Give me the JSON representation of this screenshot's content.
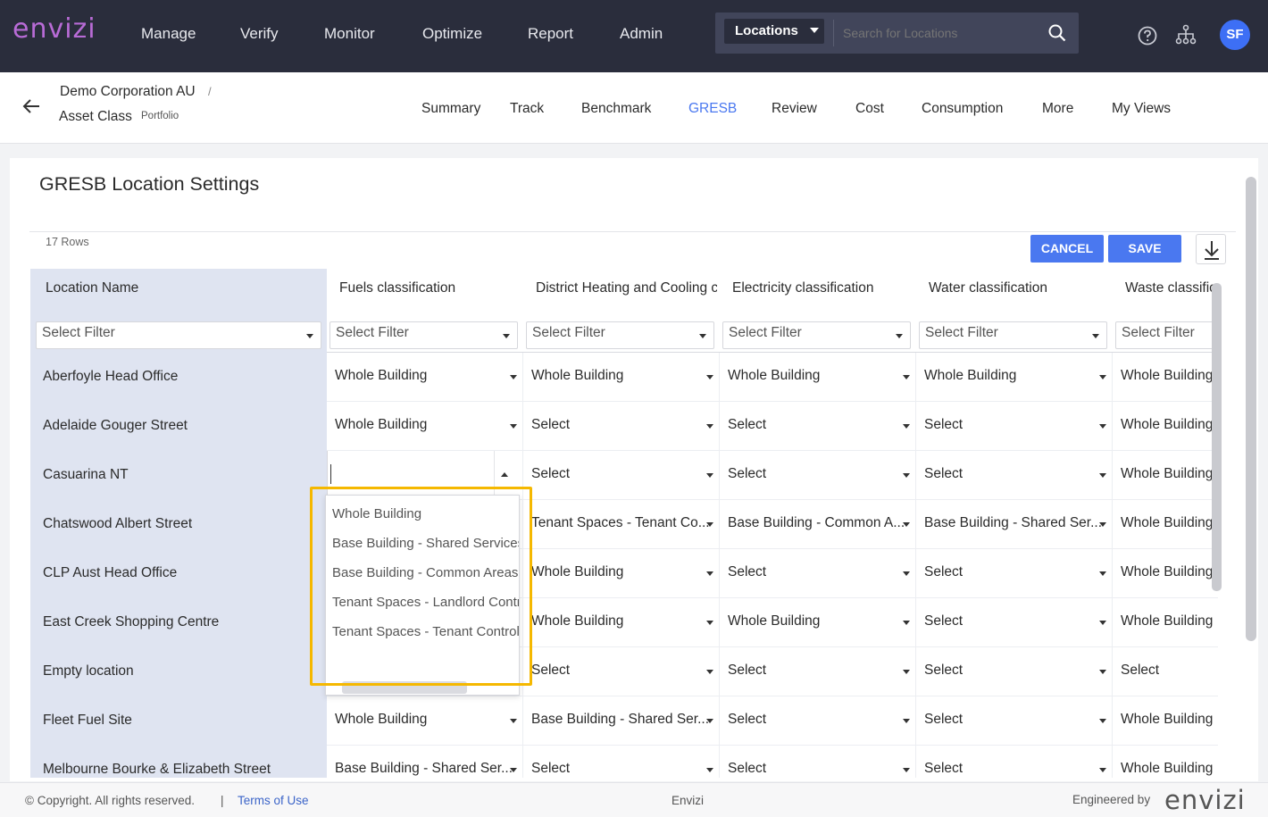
{
  "app": {
    "logo": "envizi",
    "brand_color": "#b86bd6",
    "accent_color": "#4a78f0"
  },
  "topnav": {
    "items": [
      "Manage",
      "Verify",
      "Monitor",
      "Optimize",
      "Report",
      "Admin"
    ]
  },
  "search": {
    "scope": "Locations",
    "placeholder": "Search for Locations"
  },
  "user": {
    "initials": "SF"
  },
  "breadcrumb": {
    "org": "Demo Corporation AU",
    "separator": "/",
    "group": "Asset Class",
    "group_type": "Portfolio"
  },
  "tabs": {
    "items": [
      "Summary",
      "Track",
      "Benchmark",
      "GRESB",
      "Review",
      "Cost",
      "Consumption",
      "More",
      "My Views"
    ],
    "active": "GRESB"
  },
  "panel": {
    "title": "GRESB Location Settings",
    "rows_count": "17 Rows",
    "cancel_label": "CANCEL",
    "save_label": "SAVE"
  },
  "table": {
    "columns": [
      "Location Name",
      "Fuels classification",
      "District Heating and Cooling classification",
      "Electricity classification",
      "Water classification",
      "Waste classification"
    ],
    "filter_placeholder": "Select Filter",
    "rows": [
      {
        "name": "Aberfoyle Head Office",
        "values": [
          "Whole Building",
          "Whole Building",
          "Whole Building",
          "Whole Building",
          "Whole Building"
        ]
      },
      {
        "name": "Adelaide Gouger Street",
        "values": [
          "Whole Building",
          "Select",
          "Select",
          "Select",
          "Whole Building"
        ]
      },
      {
        "name": "Casuarina NT",
        "values": [
          "",
          "Select",
          "Select",
          "Select",
          "Whole Building"
        ]
      },
      {
        "name": "Chatswood Albert Street",
        "values": [
          "",
          "Tenant Spaces - Tenant Co...",
          "Base Building - Common A...",
          "Base Building - Shared Ser...",
          "Whole Building"
        ]
      },
      {
        "name": "CLP Aust Head Office",
        "values": [
          "",
          "Whole Building",
          "Select",
          "Select",
          "Whole Building"
        ]
      },
      {
        "name": "East Creek Shopping Centre",
        "values": [
          "",
          "Whole Building",
          "Whole Building",
          "Select",
          "Whole Building"
        ]
      },
      {
        "name": "Empty location",
        "values": [
          "",
          "Select",
          "Select",
          "Select",
          "Select"
        ]
      },
      {
        "name": "Fleet Fuel Site",
        "values": [
          "Whole Building",
          "Base Building - Shared Ser...",
          "Select",
          "Select",
          "Whole Building"
        ]
      },
      {
        "name": "Melbourne Bourke & Elizabeth Street",
        "values": [
          "Base Building - Shared Ser...",
          "Select",
          "Select",
          "Select",
          "Whole Building"
        ]
      }
    ]
  },
  "dropdown": {
    "options": [
      "Whole Building",
      "Base Building - Shared Services",
      "Base Building - Common Areas",
      "Tenant Spaces - Landlord Controlled",
      "Tenant Spaces - Tenant Controlled"
    ]
  },
  "footer": {
    "copyright": "© Copyright. All rights reserved.",
    "separator": "|",
    "terms": "Terms of Use",
    "center": "Envizi",
    "engineered_by": "Engineered by",
    "logo": "envizi"
  }
}
